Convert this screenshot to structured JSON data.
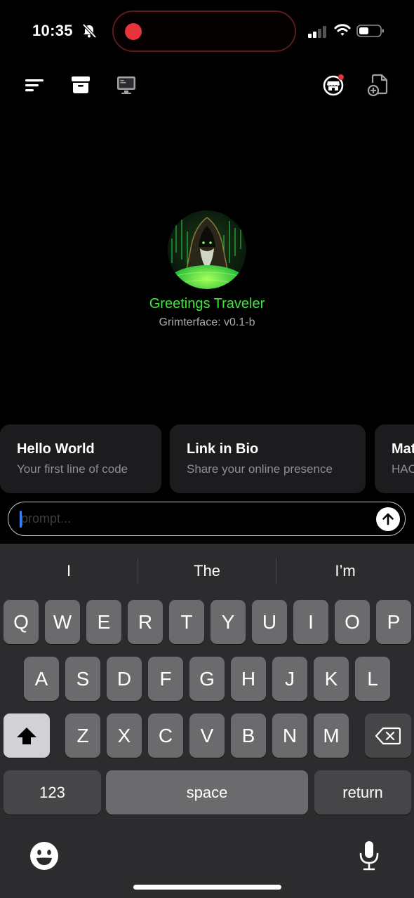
{
  "status": {
    "time": "10:35",
    "accent": "#e5343c"
  },
  "toolbar": {
    "icons": [
      "menu-icon",
      "archive-icon",
      "terminal-icon",
      "store-icon",
      "new-document-icon"
    ]
  },
  "hero": {
    "greeting": "Greetings Traveler",
    "version": "Grimterface: v0.1-b",
    "greeting_color": "#3ee83a"
  },
  "suggestions": [
    {
      "title": "Hello World",
      "subtitle": "Your first line of code"
    },
    {
      "title": "Link in Bio",
      "subtitle": "Share your online presence"
    },
    {
      "title": "Mat",
      "subtitle": "HAC"
    }
  ],
  "prompt": {
    "placeholder": "prompt..."
  },
  "keyboard": {
    "predictions": [
      "I",
      "The",
      "I’m"
    ],
    "row1": [
      "Q",
      "W",
      "E",
      "R",
      "T",
      "Y",
      "U",
      "I",
      "O",
      "P"
    ],
    "row2": [
      "A",
      "S",
      "D",
      "F",
      "G",
      "H",
      "J",
      "K",
      "L"
    ],
    "row3": [
      "Z",
      "X",
      "C",
      "V",
      "B",
      "N",
      "M"
    ],
    "numbers_label": "123",
    "space_label": "space",
    "return_label": "return"
  }
}
